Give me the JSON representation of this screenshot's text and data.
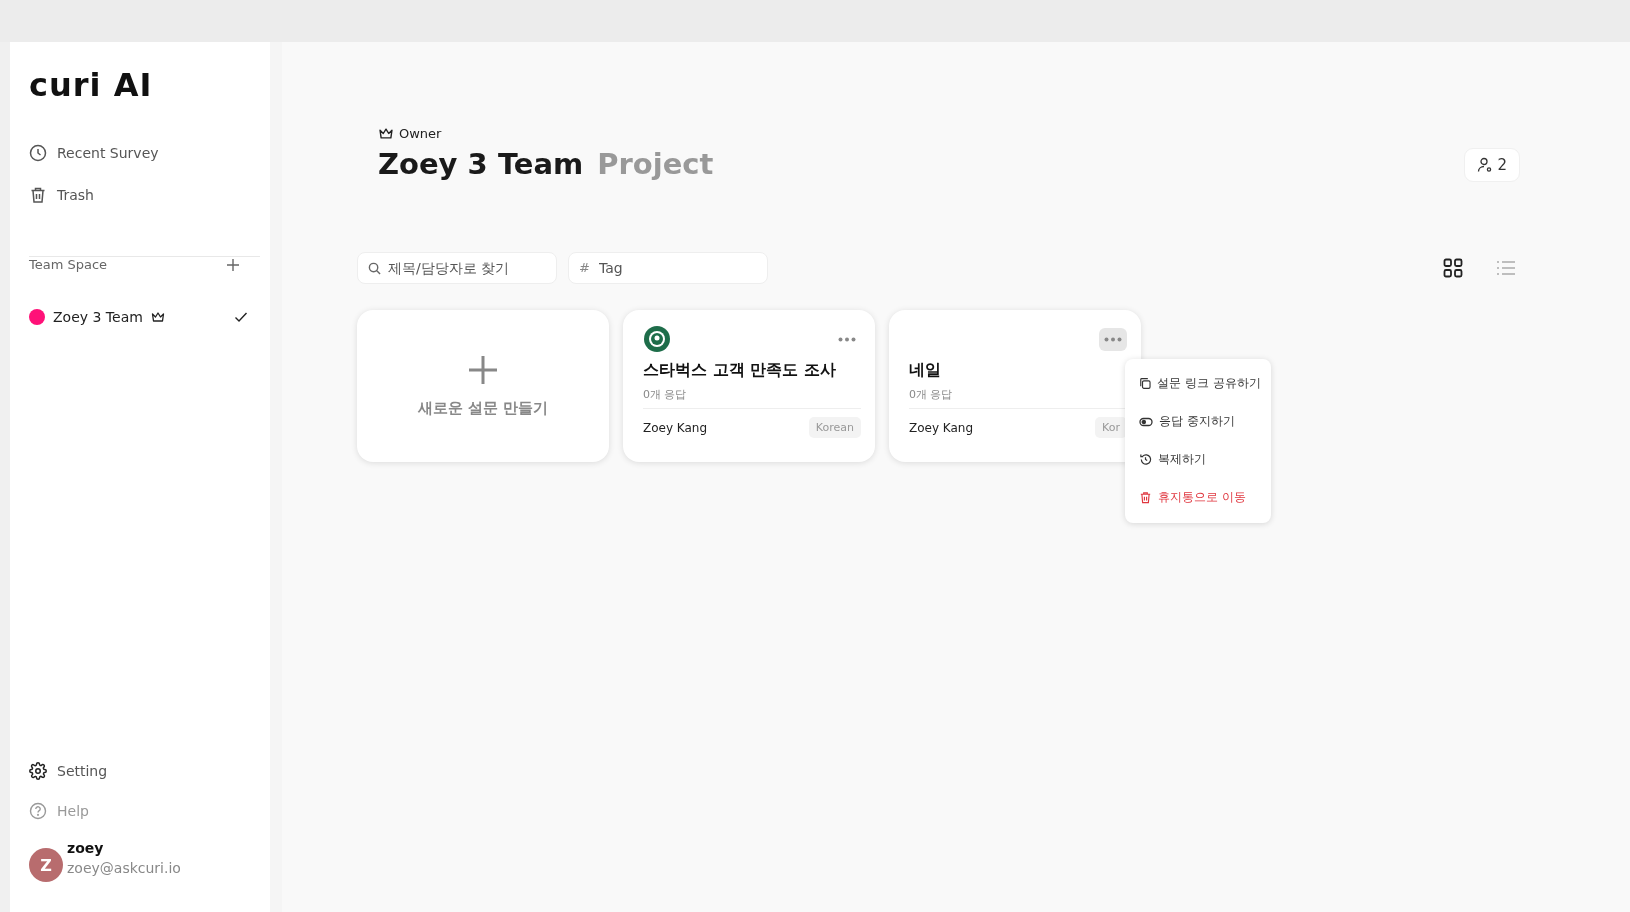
{
  "sidebar": {
    "logo": "curi AI",
    "nav": [
      {
        "label": "Recent Survey",
        "kind": "clock"
      },
      {
        "label": "Trash",
        "kind": "trash"
      }
    ],
    "team_space": {
      "label": "Team Space",
      "teams": [
        {
          "name": "Zoey 3 Team",
          "color": "#ff1178",
          "owner": true,
          "selected": true
        }
      ]
    },
    "bottom_nav": [
      {
        "label": "Setting",
        "kind": "gear",
        "dimmed": false
      },
      {
        "label": "Help",
        "kind": "help",
        "dimmed": true
      }
    ],
    "user": {
      "initial": "Z",
      "name": "zoey",
      "email": "zoey@askcuri.io"
    }
  },
  "header": {
    "role": "Owner",
    "team": "Zoey 3 Team",
    "subtitle": "Project",
    "members": "2"
  },
  "filters": {
    "search_placeholder": "제목/담당자로 찾기",
    "tag_placeholder": "Tag",
    "tag_symbol": "#"
  },
  "views": [
    {
      "kind": "grid",
      "selected": true
    },
    {
      "kind": "list",
      "selected": false
    }
  ],
  "new_card": {
    "label": "새로운 설문 만들기"
  },
  "cards": [
    {
      "title": "스타벅스 고객 만족도 조사",
      "responses": "0개 응답",
      "author": "Zoey Kang",
      "language": "Korean",
      "has_logo": true,
      "menu_open": false
    },
    {
      "title": "네일",
      "responses": "0개 응답",
      "author": "Zoey Kang",
      "language": "Kor",
      "has_logo": false,
      "menu_open": true
    }
  ],
  "menu": [
    {
      "label": "설문 링크 공유하기",
      "kind": "copy"
    },
    {
      "label": "응답 중지하기",
      "kind": "toggle"
    },
    {
      "label": "복제하기",
      "kind": "duplicate"
    },
    {
      "label": "휴지통으로 이동",
      "kind": "delete"
    }
  ]
}
